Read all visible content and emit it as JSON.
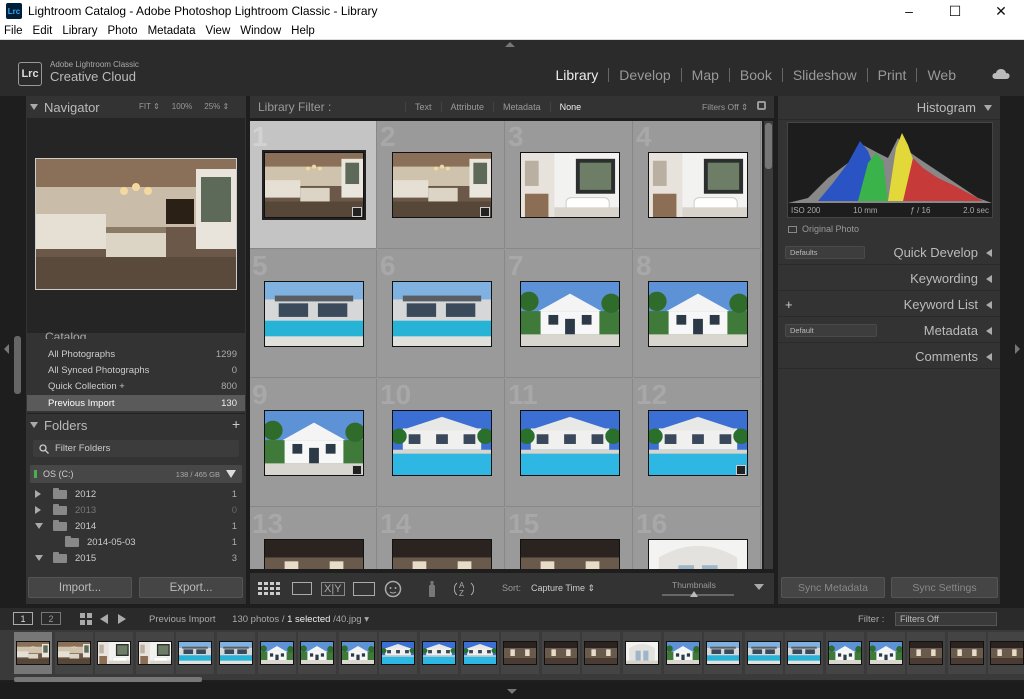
{
  "window": {
    "title": "Lightroom Catalog - Adobe Photoshop Lightroom Classic - Library",
    "app_icon": "Lrc",
    "controls": [
      "–",
      "☐",
      "✕"
    ]
  },
  "menu": [
    "File",
    "Edit",
    "Library",
    "Photo",
    "Metadata",
    "View",
    "Window",
    "Help"
  ],
  "brand": {
    "logo": "Lrc",
    "line1": "Adobe Lightroom Classic",
    "line2": "Creative Cloud"
  },
  "modules": [
    {
      "label": "Library",
      "active": true
    },
    {
      "label": "Develop"
    },
    {
      "label": "Map"
    },
    {
      "label": "Book"
    },
    {
      "label": "Slideshow"
    },
    {
      "label": "Print"
    },
    {
      "label": "Web"
    }
  ],
  "navigator": {
    "title": "Navigator",
    "zoom": [
      "FIT ⇕",
      "100%",
      "25% ⇕"
    ]
  },
  "catalog": {
    "title": "Catalog",
    "items": [
      {
        "label": "All Photographs",
        "count": "1299"
      },
      {
        "label": "All Synced Photographs",
        "count": "0"
      },
      {
        "label": "Quick Collection  +",
        "count": "800"
      },
      {
        "label": "Previous Import",
        "count": "130",
        "selected": true
      }
    ]
  },
  "folders": {
    "title": "Folders",
    "add": "+",
    "filter_placeholder": "Filter Folders",
    "volume": {
      "name": "OS (C:)",
      "space": "138 / 465 GB"
    },
    "items": [
      {
        "name": "2012",
        "count": "1",
        "expanded": false,
        "indent": 0,
        "dim": false
      },
      {
        "name": "2013",
        "count": "0",
        "expanded": false,
        "indent": 0,
        "dim": true
      },
      {
        "name": "2014",
        "count": "1",
        "expanded": true,
        "indent": 0,
        "dim": false
      },
      {
        "name": "2014-05-03",
        "count": "1",
        "expanded": false,
        "indent": 1,
        "dim": false
      },
      {
        "name": "2015",
        "count": "3",
        "expanded": true,
        "indent": 0,
        "dim": false
      }
    ]
  },
  "buttons": {
    "import": "Import...",
    "export": "Export...",
    "sync_metadata": "Sync Metadata",
    "sync_settings": "Sync Settings"
  },
  "library_filter": {
    "title": "Library Filter :",
    "options": [
      {
        "label": "Text"
      },
      {
        "label": "Attribute"
      },
      {
        "label": "Metadata"
      },
      {
        "label": "None",
        "selected": true
      }
    ],
    "filters_off": "Filters Off ⇕"
  },
  "grid": {
    "cells": [
      {
        "num": "1",
        "scene": "kitchen",
        "selected": true,
        "badge": true
      },
      {
        "num": "2",
        "scene": "kitchen",
        "badge": true
      },
      {
        "num": "3",
        "scene": "bath"
      },
      {
        "num": "4",
        "scene": "bath"
      },
      {
        "num": "5",
        "scene": "pool"
      },
      {
        "num": "6",
        "scene": "pool"
      },
      {
        "num": "7",
        "scene": "house"
      },
      {
        "num": "8",
        "scene": "house"
      },
      {
        "num": "9",
        "scene": "house",
        "badge": true
      },
      {
        "num": "10",
        "scene": "poolday"
      },
      {
        "num": "11",
        "scene": "poolday"
      },
      {
        "num": "12",
        "scene": "poolday",
        "badge": true
      },
      {
        "num": "13",
        "scene": "interior"
      },
      {
        "num": "14",
        "scene": "interior"
      },
      {
        "num": "15",
        "scene": "interior"
      },
      {
        "num": "16",
        "scene": "bright"
      }
    ]
  },
  "toolbar": {
    "sort_label": "Sort:",
    "sort_value": "Capture Time ⇕",
    "thumbnails_label": "Thumbnails",
    "thumbnail_size": 0.45
  },
  "histogram": {
    "title": "Histogram",
    "iso": "ISO 200",
    "focal": "10 mm",
    "aperture": "ƒ / 16",
    "shutter": "2.0 sec",
    "original_photo": "Original Photo"
  },
  "right_panels": {
    "quick_develop": "Quick Develop",
    "quick_develop_preset": "Defaults",
    "keywording": "Keywording",
    "keyword_list": "Keyword List",
    "keyword_add": "+",
    "metadata": "Metadata",
    "metadata_preset": "Default",
    "comments": "Comments"
  },
  "filmstrip": {
    "page1": "1",
    "page2": "2",
    "source": "Previous Import",
    "count_text": "130 photos /",
    "selected_text": "1 selected",
    "file_text": "/40.jpg ▾",
    "filter_label": "Filter :",
    "filter_value": "Filters Off",
    "scenes": [
      "kitchen",
      "kitchen",
      "bath",
      "bath",
      "pool",
      "pool",
      "house",
      "house",
      "house",
      "poolday",
      "poolday",
      "poolday",
      "interior",
      "interior",
      "interior",
      "bright",
      "house",
      "pool",
      "pool",
      "pool",
      "house",
      "house",
      "interior",
      "interior",
      "interior"
    ]
  },
  "colors": {
    "panel": "#333333",
    "grid_bg": "#9a9a9a",
    "selected_cell": "#c4c4c4",
    "accent_text": "#eeeeee"
  }
}
